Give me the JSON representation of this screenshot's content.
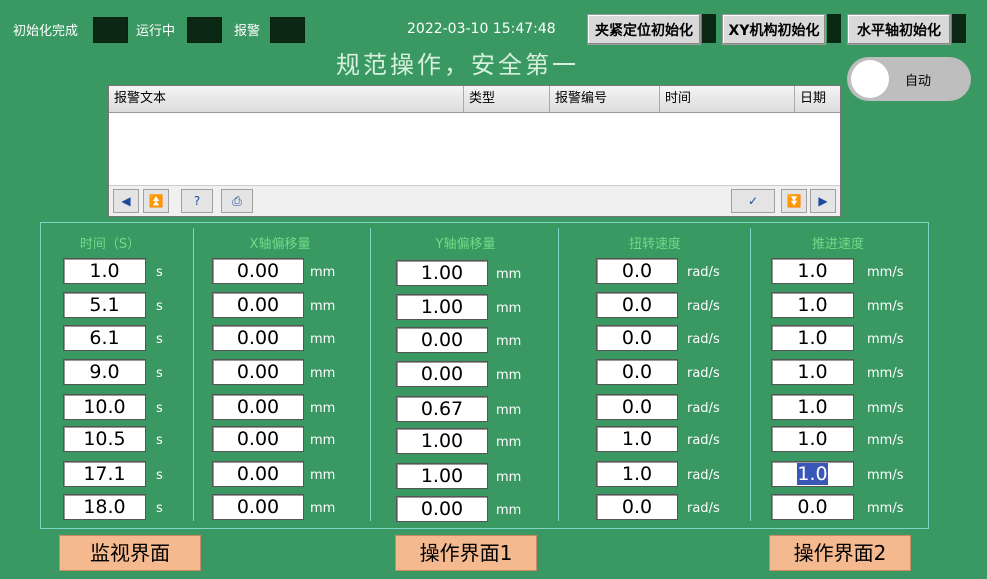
{
  "status": {
    "init_done": "初始化完成",
    "running": "运行中",
    "alarm": "报警"
  },
  "datetime": "2022-03-10 15:47:48",
  "buttons": {
    "clamp_init": "夹紧定位初始化",
    "xy_init": "XY机构初始化",
    "horizontal_init": "水平轴初始化"
  },
  "slogan": "规范操作，安全第一",
  "mode_toggle": {
    "label": "自动"
  },
  "alarm_table": {
    "columns": [
      "报警文本",
      "类型",
      "报警编号",
      "时间",
      "日期"
    ]
  },
  "data_table": {
    "columns": [
      {
        "header": "时间（S）",
        "unit": "s",
        "values": [
          "1.0",
          "5.1",
          "6.1",
          "9.0",
          "10.0",
          "10.5",
          "17.1",
          "18.0"
        ]
      },
      {
        "header": "X轴偏移量",
        "unit": "mm",
        "values": [
          "0.00",
          "0.00",
          "0.00",
          "0.00",
          "0.00",
          "0.00",
          "0.00",
          "0.00"
        ]
      },
      {
        "header": "Y轴偏移量",
        "unit": "mm",
        "values": [
          "1.00",
          "1.00",
          "0.00",
          "0.00",
          "0.67",
          "1.00",
          "1.00",
          "0.00"
        ]
      },
      {
        "header": "扭转速度",
        "unit": "rad/s",
        "values": [
          "0.0",
          "0.0",
          "0.0",
          "0.0",
          "0.0",
          "1.0",
          "1.0",
          "0.0"
        ]
      },
      {
        "header": "推进速度",
        "unit": "mm/s",
        "values": [
          "1.0",
          "1.0",
          "1.0",
          "1.0",
          "1.0",
          "1.0",
          "1.0",
          "0.0"
        ]
      }
    ]
  },
  "nav": {
    "monitor": "监视界面",
    "operation1": "操作界面1",
    "operation2": "操作界面2"
  },
  "colors": {
    "background": "#3a9862",
    "indicator_off": "#0b2814",
    "nav_button": "#f5b990",
    "column_header": "#6fdc86"
  }
}
